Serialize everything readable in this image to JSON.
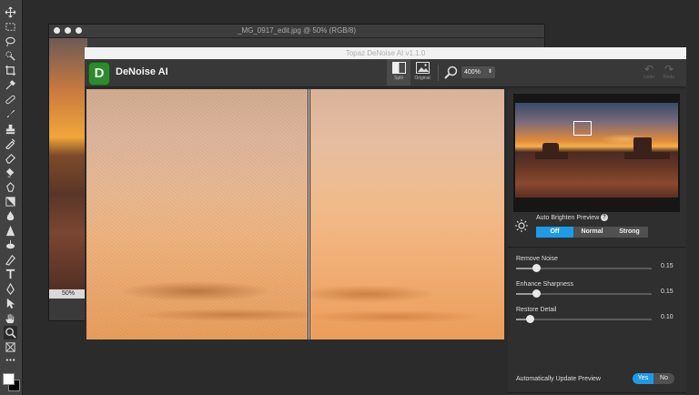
{
  "photoshop": {
    "document_title": "_MG_0917_edit.jpg @ 50% (RGB/8)",
    "zoom_level": "50%",
    "tools": [
      "move-icon",
      "marquee-icon",
      "lasso-icon",
      "quick-select-icon",
      "crop-icon",
      "eyedropper-icon",
      "healing-brush-icon",
      "brush-icon",
      "clone-stamp-icon",
      "history-brush-icon",
      "eraser-icon",
      "gradient-icon",
      "blur-icon",
      "dodge-icon",
      "pen-icon",
      "type-icon",
      "path-select-icon",
      "shape-icon",
      "hand-icon",
      "zoom-icon",
      "more-icon"
    ],
    "foreground_color": "#ffffff",
    "background_color": "#000000"
  },
  "denoise": {
    "window_title": "Topaz DeNoise AI v1.1.0",
    "logo_letter": "D",
    "app_name": "DeNoise AI",
    "views": [
      {
        "label": "Split",
        "active": true
      },
      {
        "label": "Original",
        "active": false
      }
    ],
    "zoom": "400%",
    "undo_label": "Undo",
    "redo_label": "Redo",
    "auto_brighten": {
      "label": "Auto Brighten Preview",
      "help": "?",
      "options": [
        "Off",
        "Normal",
        "Strong"
      ],
      "selected": "Off"
    },
    "sliders": [
      {
        "label": "Remove Noise",
        "value": "0.15",
        "fraction": 0.15
      },
      {
        "label": "Enhance Sharpness",
        "value": "0.15",
        "fraction": 0.15
      },
      {
        "label": "Restore Detail",
        "value": "0.10",
        "fraction": 0.1
      }
    ],
    "auto_update": {
      "label": "Automatically Update Preview",
      "options": [
        "Yes",
        "No"
      ],
      "selected": "Yes"
    },
    "accent_color": "#1e9be6",
    "logo_color": "#2f8a2f"
  }
}
